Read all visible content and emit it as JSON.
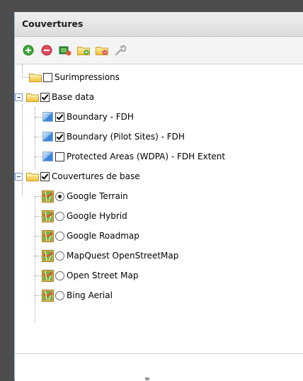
{
  "panel": {
    "title": "Couvertures"
  },
  "toolbar": {
    "buttons": [
      {
        "icon": "add-icon",
        "color": "#3aaa35"
      },
      {
        "icon": "remove-icon",
        "color": "#e04b5e"
      },
      {
        "icon": "add-layer-icon",
        "color": "#2f8f3a"
      },
      {
        "icon": "add-folder-icon",
        "color": "#f2c94c"
      },
      {
        "icon": "remove-folder-icon",
        "color": "#f2c94c"
      },
      {
        "icon": "wrench-icon",
        "color": "#b0b0b0"
      }
    ]
  },
  "tree": {
    "surimpressions": {
      "label": "Surimpressions",
      "checked": false
    },
    "base_data": {
      "label": "Base data",
      "checked": true,
      "children": [
        {
          "label": "Boundary - FDH",
          "checked": true
        },
        {
          "label": "Boundary (Pilot Sites) - FDH",
          "checked": true
        },
        {
          "label": "Protected Areas (WDPA) - FDH Extent",
          "checked": false
        }
      ]
    },
    "couvertures_de_base": {
      "label": "Couvertures de base",
      "checked": true,
      "children": [
        {
          "label": "Google Terrain",
          "selected": true
        },
        {
          "label": "Google Hybrid",
          "selected": false
        },
        {
          "label": "Google Roadmap",
          "selected": false
        },
        {
          "label": "MapQuest OpenStreetMap",
          "selected": false
        },
        {
          "label": "Open Street Map",
          "selected": false
        },
        {
          "label": "Bing Aerial",
          "selected": false
        }
      ]
    }
  }
}
